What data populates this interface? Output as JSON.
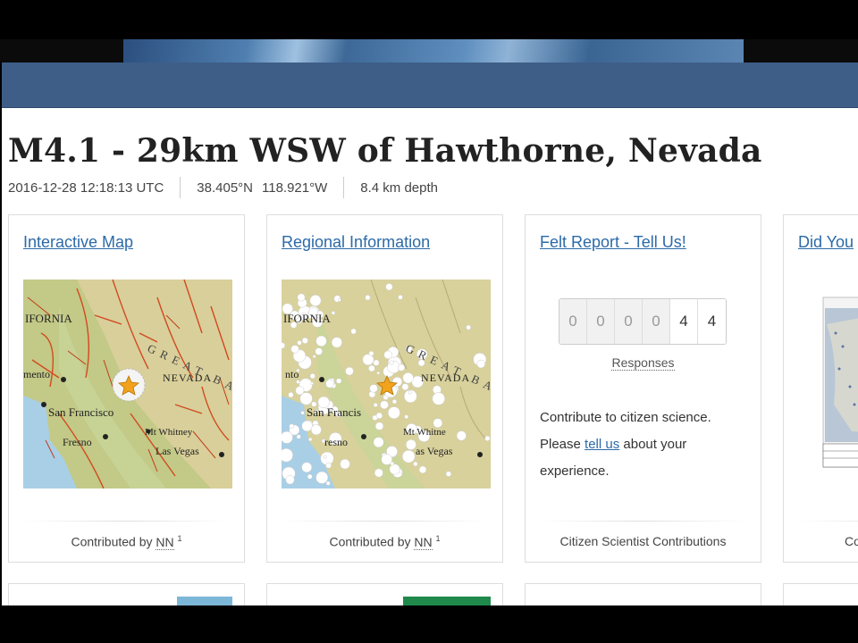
{
  "event": {
    "title": "M4.1 - 29km WSW of Hawthorne, Nevada",
    "time": "2016-12-28 12:18:13 UTC",
    "lat": "38.405°N",
    "lon": "118.921°W",
    "depth": "8.4 km depth"
  },
  "cards": {
    "map": {
      "link": "Interactive Map",
      "footer_prefix": "Contributed by",
      "footer_nn": "NN",
      "footer_sup": "1",
      "labels": {
        "state_ca": "IFORNIA",
        "region": "GREAT BA",
        "state_nv": "NEVADA",
        "city_sac": "mento",
        "city_sf": "San Francisco",
        "city_fresno": "Fresno",
        "peak": "Mt Whitney",
        "city_lv": "Las Vegas"
      }
    },
    "regional": {
      "link": "Regional Information",
      "footer_prefix": "Contributed by",
      "footer_nn": "NN",
      "footer_sup": "1",
      "labels": {
        "state_ca": "IFORNIA",
        "region": "GREAT BA",
        "state_nv": "NEVADA",
        "city_sac": "nto",
        "city_sf": "San Francis",
        "city_fresno": "resno",
        "peak": "Mt Whitne",
        "city_lv": "as Vegas"
      }
    },
    "felt": {
      "link": "Felt Report - Tell Us!",
      "digits": [
        "0",
        "0",
        "0",
        "0",
        "4",
        "4"
      ],
      "responses_label": "Responses",
      "body_text": "Contribute to citizen science. Please",
      "body_link": "tell us",
      "body_end": "about your experience.",
      "footer": "Citizen Scientist Contributions"
    },
    "dyfi": {
      "link": "Did You",
      "footer": "Co"
    }
  },
  "colors": {
    "navbar": "#3e5e87",
    "link": "#2c6aa8",
    "title": "#222222"
  }
}
